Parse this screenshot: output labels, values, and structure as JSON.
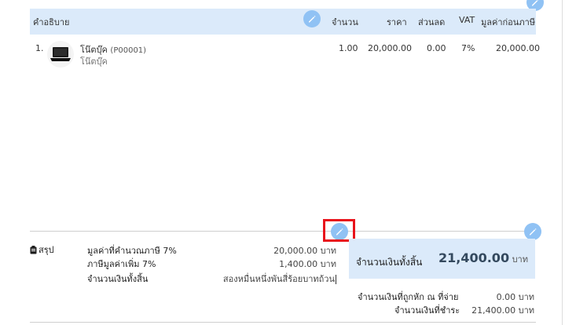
{
  "table": {
    "headers": {
      "description": "คำอธิบาย",
      "quantity": "จำนวน",
      "price": "ราคา",
      "discount": "ส่วนลด",
      "vat": "VAT",
      "pretax": "มูลค่าก่อนภาษี"
    },
    "rows": [
      {
        "index": "1.",
        "name": "โน๊ตบุ๊ค",
        "code": "(P00001)",
        "subtitle": "โน๊ตบุ๊ค",
        "quantity": "1.00",
        "price": "20,000.00",
        "discount": "0.00",
        "vat": "7%",
        "pretax": "20,000.00"
      }
    ]
  },
  "summary": {
    "title": "สรุป",
    "taxable_label": "มูลค่าที่คำนวณภาษี 7%",
    "taxable_value": "20,000.00 บาท",
    "vat_label": "ภาษีมูลค่าเพิ่ม 7%",
    "vat_value": "1,400.00 บาท",
    "total_text_label": "จำนวนเงินทั้งสิ้น",
    "total_text_value": "สองหมื่นหนึ่งพันสี่ร้อยบาทถ้วน"
  },
  "totals": {
    "grand_label": "จำนวนเงินทั้งสิ้น",
    "grand_amount": "21,400.00",
    "grand_unit": "บาท",
    "withheld_label": "จำนวนเงินที่ถูกหัก ณ ที่จ่าย",
    "withheld_value": "0.00 บาท",
    "payable_label": "จำนวนเงินที่ชำระ",
    "payable_value": "21,400.00 บาท"
  },
  "colors": {
    "header_bg": "#dbeafa",
    "edit_button": "#90c2f4",
    "highlight": "#e8131b",
    "grand_amount": "#34495e"
  },
  "icons": {
    "edit": "pencil-icon",
    "summary": "clipboard-icon",
    "product": "laptop-icon"
  }
}
